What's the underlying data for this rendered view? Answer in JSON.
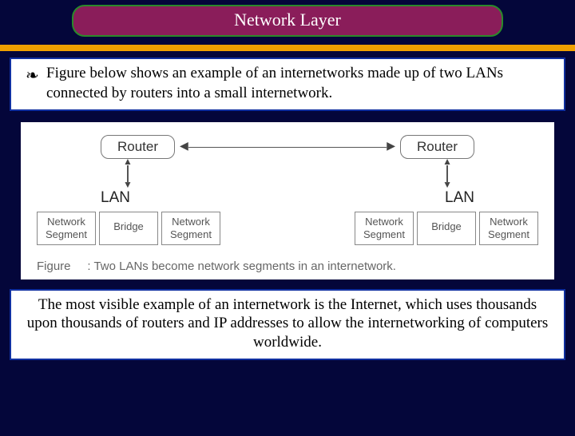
{
  "title": "Network Layer",
  "bullet_glyph": "❧",
  "body_text": "Figure below shows an example of an internetworks made up of two LANs connected by routers into a small internetwork.",
  "diagram": {
    "router_label": "Router",
    "lan_label": "LAN",
    "segment_label": "Network\nSegment",
    "bridge_label": "Bridge",
    "caption_prefix": "Figure",
    "caption_text": ": Two LANs become network segments in an internetwork."
  },
  "bottom_text": "The most visible example of an internetwork is the Internet, which uses thousands upon thousands of routers and IP addresses to allow the internetworking of computers worldwide."
}
